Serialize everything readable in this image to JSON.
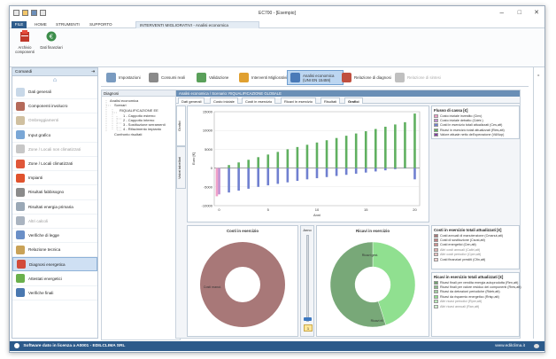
{
  "window": {
    "title": "EC700 - [Esempio]",
    "minimize": "–",
    "maximize": "□",
    "close": "✕"
  },
  "ribbon_tabs": [
    "FILE",
    "HOME",
    "STRUMENTI",
    "SUPPORTO"
  ],
  "ribbon_context_tab": "INTERVENTI MIGLIORATIVI - Analisi economica",
  "ribbon_buttons": [
    {
      "label": "Archivio componenti"
    },
    {
      "label": "Dati finanziari"
    }
  ],
  "left_pane": {
    "header": "Comandi",
    "pin": "⇥",
    "home": "⌂",
    "items": [
      {
        "label": "Dati generali",
        "color": "#c8d8e8",
        "dim": false
      },
      {
        "label": "Componenti involucro",
        "color": "#b56a5a",
        "dim": false
      },
      {
        "label": "Ombreggiamenti",
        "color": "#d0c0a0",
        "dim": true
      },
      {
        "label": "Input grafico",
        "color": "#7aa7d6",
        "dim": false
      },
      {
        "label": "Zone / Locali non climatizzati",
        "color": "#c7c7c7",
        "dim": true
      },
      {
        "label": "Zone / Locali climatizzati",
        "color": "#e0573a",
        "dim": false
      },
      {
        "label": "Impianti",
        "color": "#e0532e",
        "dim": false
      },
      {
        "label": "Risultati fabbisogno",
        "color": "#8b8b8b",
        "dim": false
      },
      {
        "label": "Risultati energia primaria",
        "color": "#9aa8b6",
        "dim": false
      },
      {
        "label": "Altri calcoli",
        "color": "#aab4c0",
        "dim": true
      },
      {
        "label": "Verifiche di legge",
        "color": "#6a8fc7",
        "dim": false
      },
      {
        "label": "Relazione tecnica",
        "color": "#c9a257",
        "dim": false
      },
      {
        "label": "Diagnosi energetica",
        "color": "#d24b3a",
        "dim": false
      },
      {
        "label": "Attestati energetici",
        "color": "#6ab04c",
        "dim": false
      },
      {
        "label": "Verifiche finali",
        "color": "#4a78b0",
        "dim": false
      }
    ],
    "selected_index": 12
  },
  "toolstrip": [
    {
      "label": "Impostazioni",
      "color": "#7a9bc0",
      "sel": false,
      "dim": false
    },
    {
      "label": "Consumi reali",
      "color": "#8a8a8a",
      "sel": false,
      "dim": false
    },
    {
      "label": "Validazione",
      "color": "#5aa05a",
      "sel": false,
      "dim": false
    },
    {
      "label": "Interventi Migliorativi",
      "color": "#e0a030",
      "sel": false,
      "dim": false
    },
    {
      "label": "Analisi economica (UNI EN 15459)",
      "color": "#4a7ab8",
      "sel": true,
      "dim": false
    },
    {
      "label": "Relazione di diagnosi",
      "color": "#c05040",
      "sel": false,
      "dim": false
    },
    {
      "label": "Relazione di sintesi",
      "color": "#c0c0c0",
      "sel": false,
      "dim": true
    }
  ],
  "tree": {
    "header": "Diagnosi",
    "nodes": [
      "Analisi economica",
      "Scenari",
      "RIQUALIFICAZIONE EE",
      "1 - Cappotto esterno",
      "2 - Cappotto interno",
      "3 - Sostituzione serramenti",
      "4 - Rifacimento impianto",
      "Confronto risultati"
    ]
  },
  "content": {
    "header": "Analisi economica / Scenario: RIQUALIFICAZIONE GLOBALE",
    "tabs": [
      "Dati generali",
      "Costo iniziale",
      "Costi in esercizio",
      "Ricavi in esercizio",
      "Risultati",
      "Grafici"
    ],
    "selected_tab": 5,
    "vtab_top": "Grafici",
    "vtab_bottom": "Valori tabellari",
    "pie_left_title": "Costi in esercizio",
    "pie_right_title": "Ricavi in esercizio",
    "anno_label": "Anno",
    "anno_value": "1",
    "pie_left_label": "Costi manut.",
    "pie_right_label_1": "Ricavi gest.",
    "pie_right_label_2": "Ricavi rif."
  },
  "legends": [
    {
      "title": "Flusso di cassa [€]",
      "items": [
        {
          "label": "Costo iniziale investito (Cinv)",
          "color": "#f0a0c8",
          "dim": false
        },
        {
          "label": "Costo iniziale detratto (Cdetr.)",
          "color": "#c090d0",
          "dim": false
        },
        {
          "label": "Costi in esercizio totali attualizzati (Ces,att)",
          "color": "#7080d0",
          "dim": false
        },
        {
          "label": "Ricavi in esercizio totali attualizzati (Ries,att)",
          "color": "#60b060",
          "dim": false
        },
        {
          "label": "Valore attuale netto dell'operazione (VANop)",
          "color": "#8040a0",
          "dim": false
        }
      ]
    },
    {
      "title": "Costi in esercizio totali attualizzati [€]",
      "items": [
        {
          "label": "Costi annuali di manutenzione (Cmanut,att)",
          "color": "#a87878",
          "dim": false
        },
        {
          "label": "Costi di sostituzione (Csost,att)",
          "color": "#c08080",
          "dim": false
        },
        {
          "label": "Costi energetici (Cen,att)",
          "color": "#d09090",
          "dim": false
        },
        {
          "label": "Altri costi annuali (Caltri,att)",
          "color": "#e0b0b0",
          "dim": true
        },
        {
          "label": "Altri costi periodici (Cper,att)",
          "color": "#e8c0c0",
          "dim": true
        },
        {
          "label": "Costi finanziari prestiti (Cfin,att)",
          "color": "#f0d0d0",
          "dim": false
        }
      ]
    },
    {
      "title": "Ricavi in esercizio totali attualizzati [€]",
      "items": [
        {
          "label": "Ricavi finali per vendita energia autoprodotta (Ren,att)",
          "color": "#70a070",
          "dim": false
        },
        {
          "label": "Ricavi finali per valore residuo dei componenti (Rres,att)",
          "color": "#88bb88",
          "dim": false
        },
        {
          "label": "Ricavi da detrazioni periodiche (Rdetr,att)",
          "color": "#a0d0a0",
          "dim": false
        },
        {
          "label": "Ricavi da risparmio energetico (Rrisp,att)",
          "color": "#90e090",
          "dim": false
        },
        {
          "label": "Altri ricavi periodici (Rper,att)",
          "color": "#b8ecb8",
          "dim": true
        },
        {
          "label": "Altri ricavi annuali (Ran,att)",
          "color": "#d0f4d0",
          "dim": true
        }
      ]
    }
  ],
  "statusbar": {
    "left": "Software dato in licenza a A0001 - EDILCLIMA SRL",
    "right": "www.edilclima.it"
  },
  "chart_data": [
    {
      "type": "bar",
      "title": "",
      "xlabel": "Anni",
      "ylabel": "Euro [€]",
      "x": [
        0,
        1,
        2,
        3,
        4,
        5,
        6,
        7,
        8,
        9,
        10,
        11,
        12,
        13,
        14,
        15,
        16,
        17,
        18,
        19,
        20
      ],
      "ylim": [
        -10000,
        15000
      ],
      "yticks": [
        "15000",
        "10000",
        "5000",
        "0",
        "-5000",
        "-10000"
      ],
      "xticks": [
        "0",
        "5",
        "10",
        "15",
        "20"
      ],
      "series": [
        {
          "name": "Costo iniziale investito (Cinv)",
          "color": "#f0a0c8",
          "values": [
            -7500,
            0,
            0,
            0,
            0,
            0,
            0,
            0,
            0,
            0,
            0,
            0,
            0,
            0,
            0,
            0,
            0,
            0,
            0,
            0,
            0
          ]
        },
        {
          "name": "Costo iniziale detratto (Cdetr.)",
          "color": "#c090d0",
          "values": [
            -7000,
            0,
            0,
            0,
            0,
            0,
            0,
            0,
            0,
            0,
            0,
            0,
            0,
            0,
            0,
            0,
            0,
            0,
            0,
            0,
            0
          ]
        },
        {
          "name": "Ricavi in esercizio totali attualizzati (Ries,att)",
          "color": "#60b060",
          "values": [
            0,
            800,
            1500,
            2200,
            2900,
            3600,
            4300,
            5000,
            5600,
            6200,
            6800,
            7400,
            8000,
            8600,
            9200,
            9800,
            10400,
            11000,
            11600,
            12200,
            14500
          ]
        },
        {
          "name": "Costi in esercizio totali attualizzati (Ces,att)",
          "color": "#7080d0",
          "values": [
            0,
            -6500,
            -6000,
            -5500,
            -5000,
            -4600,
            -4200,
            -3800,
            -3400,
            -3000,
            -2700,
            -2400,
            -2100,
            -1800,
            -1500,
            -1200,
            -900,
            -600,
            -300,
            -100,
            -3000
          ]
        }
      ]
    },
    {
      "type": "pie",
      "title": "Costi in esercizio",
      "labels": [
        "Costi manut."
      ],
      "values": [
        100
      ],
      "colors": [
        "#a87878"
      ]
    },
    {
      "type": "pie",
      "title": "Ricavi in esercizio",
      "labels": [
        "Ricavi gest.",
        "Ricavi rif."
      ],
      "values": [
        45,
        55
      ],
      "colors": [
        "#90e090",
        "#78a878"
      ]
    }
  ]
}
